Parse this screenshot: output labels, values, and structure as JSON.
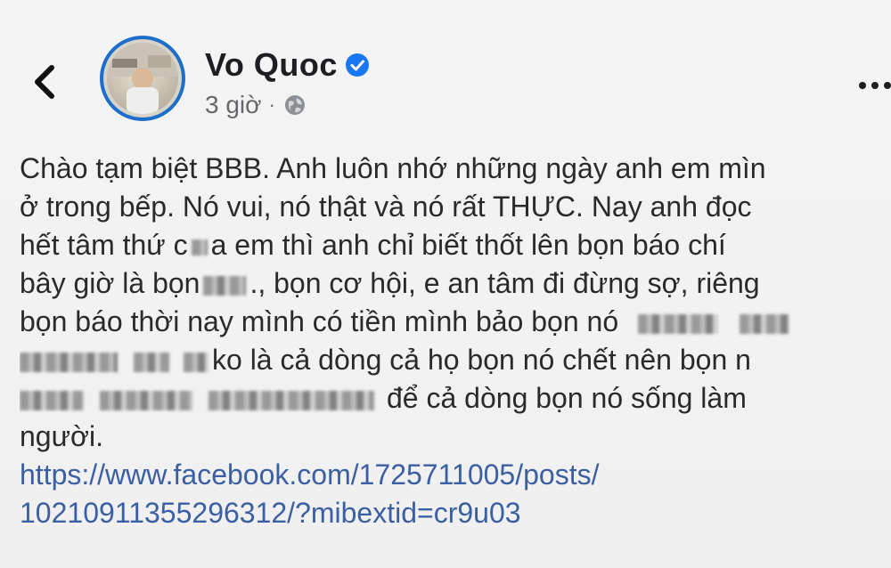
{
  "header": {
    "author_name": "Vo Quoc",
    "timestamp": "3 giờ",
    "separator": "·",
    "icons": {
      "back": "chevron-left-icon",
      "verified": "verified-badge-icon",
      "privacy": "globe-icon",
      "more": "more-options-icon"
    },
    "colors": {
      "verified": "#1877f2",
      "avatar_ring": "#1b6ec9",
      "link": "#385898"
    }
  },
  "post": {
    "line1": "Chào tạm biệt BBB. Anh luôn nhớ những ngày anh em mìn",
    "line2": "ở trong bếp. Nó vui, nó thật và nó rất THỰC. Nay anh đọc",
    "line3a": "hết tâm thứ c",
    "line3b": "a em thì anh chỉ biết thốt lên bọn báo chí",
    "line4a": "bây giờ là bọn",
    "line4b": "., bọn cơ hội, e an tâm đi đừng sợ, riêng",
    "line5a": "bọn báo thời nay mình có tiền mình bảo bọn nó",
    "line6b": "ko là cả dòng cả họ bọn nó chết nên bọn n",
    "line7b": "để cả dòng bọn nó sống làm",
    "line8": "người.",
    "link_line1": "https://www.facebook.com/1725711005/posts/",
    "link_line2": "1021091135529631​2/?mibextid=cr9u03"
  }
}
